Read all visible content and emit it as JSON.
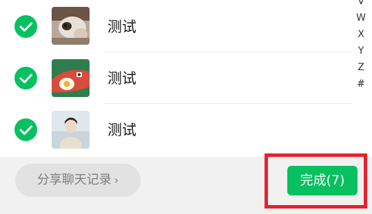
{
  "contacts": [
    {
      "name": "测试",
      "selected": true,
      "avatar": "cat-photo"
    },
    {
      "name": "测试",
      "selected": true,
      "avatar": "fried-egg-illustration"
    },
    {
      "name": "测试",
      "selected": true,
      "avatar": "person-photo"
    }
  ],
  "index_bar": [
    "V",
    "W",
    "X",
    "Y",
    "Z",
    "#"
  ],
  "bottom": {
    "share_label": "分享聊天记录",
    "share_chevron": "›",
    "done_label": "完成(7)"
  },
  "colors": {
    "accent_green": "#07c160",
    "highlight_red": "#e8212d",
    "bottom_bar_bg": "#f1f1f1"
  }
}
